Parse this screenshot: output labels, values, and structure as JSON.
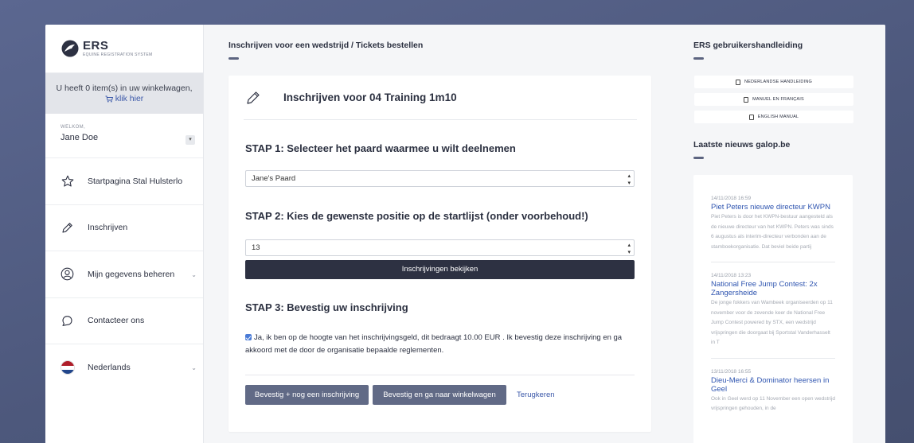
{
  "brand": {
    "name": "ERS",
    "tagline": "EQUINE REGISTRATION SYSTEM"
  },
  "cart": {
    "text": "U heeft 0 item(s) in uw winkelwagen,",
    "link": "klik hier"
  },
  "user": {
    "welcome_label": "WELKOM,",
    "name": "Jane Doe"
  },
  "sidebar": {
    "items": [
      {
        "label": "Startpagina Stal Hulsterlo",
        "icon": "star-icon"
      },
      {
        "label": "Inschrijven",
        "icon": "pencil-icon"
      },
      {
        "label": "Mijn gegevens beheren",
        "icon": "user-icon"
      },
      {
        "label": "Contacteer ons",
        "icon": "chat-icon"
      },
      {
        "label": "Nederlands",
        "icon": "flag-nl-icon"
      }
    ]
  },
  "main": {
    "page_title": "Inschrijven voor een wedstrijd / Tickets bestellen",
    "card_title": "Inschrijven voor 04 Training 1m10",
    "step1": {
      "heading": "STAP 1: Selecteer het paard waarmee u wilt deelnemen",
      "selected": "Jane's Paard"
    },
    "step2": {
      "heading": "STAP 2: Kies de gewenste positie op de startlijst (onder voorbehoud!)",
      "selected": "13",
      "view_button": "Inschrijvingen bekijken"
    },
    "step3": {
      "heading": "STAP 3: Bevestig uw inschrijving",
      "confirm_text": "Ja, ik ben op de hoogte van het inschrijvingsgeld, dit bedraagt 10.00 EUR . Ik bevestig deze inschrijving en ga akkoord met de door de organisatie bepaalde reglementen.",
      "checked": true
    },
    "buttons": {
      "confirm_another": "Bevestig + nog een inschrijving",
      "confirm_cart": "Bevestig en ga naar winkelwagen",
      "back": "Terugkeren"
    }
  },
  "right": {
    "manual_title": "ERS gebruikershandleiding",
    "manuals": [
      "NEDERLANDSE HANDLEIDING",
      "MANUEL EN FRANÇAIS",
      "ENGLISH MANUAL"
    ],
    "news_title": "Laatste nieuws galop.be",
    "news": [
      {
        "date": "14/11/2018 16:59",
        "title": "Piet Peters nieuwe directeur KWPN",
        "text": "Piet Peters is door het KWPN-bestuur aangesteld als de nieuwe directeur van het KWPN. Peters was sinds 6 augustus als interim-directeur verbonden aan de stamboekorganisatie. Dat beviel beide partij"
      },
      {
        "date": "14/11/2018 13:23",
        "title": "National Free Jump Contest: 2x Zangersheide",
        "text": "De jonge fokkers van Wambeek organiseerden op 11 november voor de zevende keer de National Free Jump Contest powered by STX, een wedstrijd vrijspringen die doorgaat bij Sportstal Vanderhasselt in T"
      },
      {
        "date": "13/11/2018 16:55",
        "title": "Dieu-Merci & Dominator heersen in Geel",
        "text": "Ook in Geel werd op 11 November een open wedstrijd vrijspringen gehouden, in de"
      }
    ]
  },
  "colors": {
    "background": "#4d587c",
    "dark_button": "#2d3142",
    "button": "#616a86",
    "link": "#3a57a8",
    "news_link": "#2f55b0",
    "checkbox": "#4a7bd6"
  }
}
